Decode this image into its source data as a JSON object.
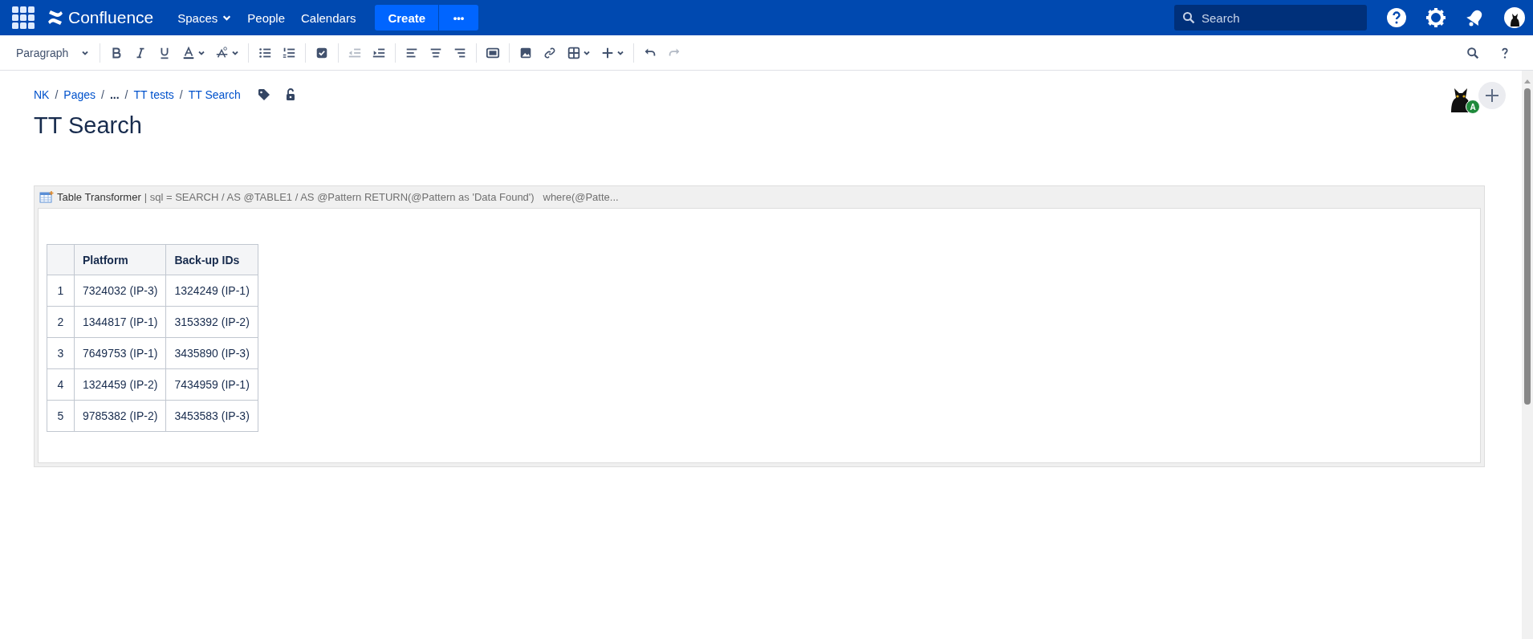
{
  "top_bar": {
    "product": "Confluence",
    "nav": [
      {
        "label": "Spaces",
        "dropdown": true
      },
      {
        "label": "People",
        "dropdown": false
      },
      {
        "label": "Calendars",
        "dropdown": false
      }
    ],
    "create_button": "Create",
    "more_button": "•••",
    "search": {
      "placeholder": "Search"
    }
  },
  "toolbar": {
    "style_dropdown": "Paragraph",
    "groups": [
      [
        {
          "kind": "bold",
          "disabled": false
        },
        {
          "kind": "italic",
          "disabled": false
        },
        {
          "kind": "underline",
          "disabled": false
        },
        {
          "kind": "text-color",
          "disabled": false
        },
        {
          "kind": "text-format",
          "disabled": false
        }
      ],
      [
        {
          "kind": "bullet-list",
          "disabled": false
        },
        {
          "kind": "numbered-list",
          "disabled": false
        }
      ],
      [
        {
          "kind": "task",
          "disabled": false
        }
      ],
      [
        {
          "kind": "outdent",
          "disabled": true
        },
        {
          "kind": "indent",
          "disabled": false
        }
      ],
      [
        {
          "kind": "align-left",
          "disabled": false
        },
        {
          "kind": "align-center",
          "disabled": false
        },
        {
          "kind": "align-right",
          "disabled": false
        }
      ],
      [
        {
          "kind": "layout",
          "disabled": false
        }
      ],
      [
        {
          "kind": "image",
          "disabled": false
        },
        {
          "kind": "link",
          "disabled": false
        },
        {
          "kind": "table",
          "disabled": false
        },
        {
          "kind": "insert",
          "disabled": false
        }
      ],
      [
        {
          "kind": "undo",
          "disabled": false
        },
        {
          "kind": "redo",
          "disabled": true
        }
      ]
    ]
  },
  "breadcrumbs": [
    {
      "kind": "link",
      "text": "NK"
    },
    {
      "kind": "separator",
      "text": "/"
    },
    {
      "kind": "link",
      "text": "Pages"
    },
    {
      "kind": "separator",
      "text": "/"
    },
    {
      "kind": "ellipsis",
      "text": "..."
    },
    {
      "kind": "separator",
      "text": "/"
    },
    {
      "kind": "link",
      "text": "TT tests"
    },
    {
      "kind": "separator",
      "text": "/"
    },
    {
      "kind": "link",
      "text": "TT Search"
    }
  ],
  "collaborator_badge": "A",
  "page_title": "TT Search",
  "macro": {
    "name": "Table Transformer",
    "params": "| sql = SEARCH / AS @TABLE1 / AS @Pattern RETURN(@Pattern as 'Data Found')   where(@Patte...",
    "table": {
      "columns": [
        "Platform",
        "Back-up IDs"
      ],
      "rows": [
        {
          "number": "1",
          "cells": [
            "7324032 (IP-3)",
            "1324249 (IP-1)"
          ]
        },
        {
          "number": "2",
          "cells": [
            "1344817 (IP-1)",
            "3153392 (IP-2)"
          ]
        },
        {
          "number": "3",
          "cells": [
            "7649753 (IP-1)",
            "3435890 (IP-3)"
          ]
        },
        {
          "number": "4",
          "cells": [
            "1324459 (IP-2)",
            "7434959 (IP-1)"
          ]
        },
        {
          "number": "5",
          "cells": [
            "9785382 (IP-2)",
            "3453583 (IP-3)"
          ]
        }
      ]
    }
  }
}
